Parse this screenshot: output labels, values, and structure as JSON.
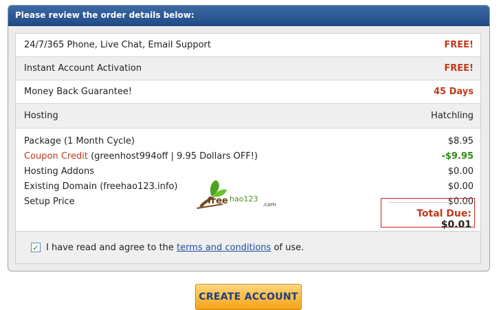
{
  "header": {
    "title": "Please review the order details below:"
  },
  "features": [
    {
      "label": "24/7/365 Phone, Live Chat, Email Support",
      "value": "FREE!"
    },
    {
      "label": "Instant Account Activation",
      "value": "FREE!"
    },
    {
      "label": "Money Back Guarantee!",
      "value": "45 Days"
    },
    {
      "label": "Hosting",
      "value": "Hatchling"
    }
  ],
  "details": {
    "package": {
      "label": "Package (1 Month Cycle)",
      "value": "$8.95"
    },
    "coupon": {
      "label": "Coupon Credit",
      "code_text": "(greenhost994off | 9.95 Dollars OFF!)",
      "value": "-$9.95"
    },
    "addons": {
      "label": "Hosting Addons",
      "value": "$0.00"
    },
    "domain": {
      "label": "Existing Domain (freehao123.info)",
      "value": "$0.00"
    },
    "setup": {
      "label": "Setup Price",
      "value": "$0.00"
    }
  },
  "total": {
    "label": "Total Due:",
    "value": "$0.01"
  },
  "agreement": {
    "checked": true,
    "text_before": "I have read and agree to the",
    "link_text": "terms and conditions",
    "text_after": "of use."
  },
  "watermark": {
    "brand": "freehao123",
    "suffix": ".com"
  },
  "create_button": {
    "label": "CREATE ACCOUNT"
  },
  "colors": {
    "header_blue": "#1f4b86",
    "price_red": "#c0391b",
    "credit_green": "#2f8a17",
    "button_orange": "#f6a21a"
  }
}
